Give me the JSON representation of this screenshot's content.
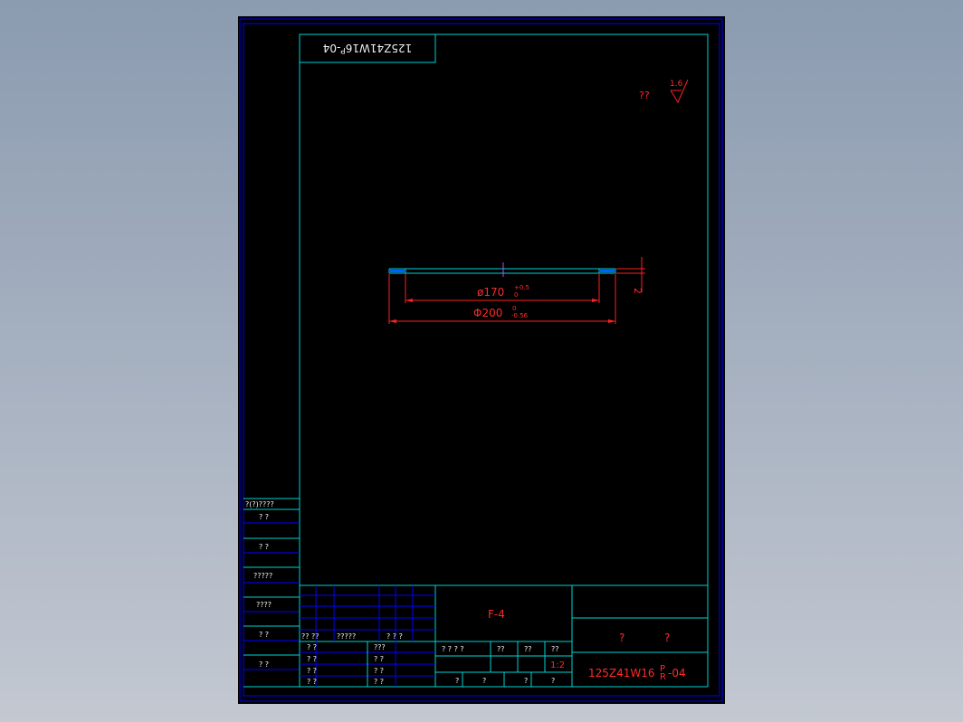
{
  "colors": {
    "background_top": "#8b9bb0",
    "sheet": "#000000",
    "frame": "#0000ff",
    "border": "#00d4d4",
    "annotation": "#ff2a2a",
    "text": "#f0f0f0"
  },
  "drawing_code_rotated": "125Z41W16",
  "drawing_code_rotated_suffix": "-04",
  "drawing_code_rotated_sup": "P",
  "roughness": {
    "value": "1.6",
    "mark": "??"
  },
  "dims": {
    "inner": {
      "prefix": "ø170",
      "upper": "+0.5",
      "lower": "0"
    },
    "outer": {
      "prefix": "Φ200",
      "upper": "0",
      "lower": "-0.56"
    },
    "thickness": "2"
  },
  "side_panel": [
    "?(?)????",
    "?   ?",
    "?   ?",
    "?????",
    "????",
    "?   ?",
    "?   ?"
  ],
  "title_block": {
    "material": "F-4",
    "name_a": "?",
    "name_b": "?",
    "code": "125Z41W16",
    "code_sup": "P",
    "code_sub": "R",
    "code_suffix": "-04",
    "scale": "1:2",
    "header_row": [
      "?? ??",
      "?????",
      "?  ?  ?"
    ],
    "left_labels": [
      "?  ?",
      "?  ?",
      "?  ?",
      "?  ?"
    ],
    "mid_labels": [
      "???",
      "?  ?",
      "?  ?",
      "?  ?"
    ],
    "stage_row": [
      "?  ?  ?  ?",
      "??",
      "??",
      "??"
    ],
    "bottom_row": [
      "?",
      "?",
      "?",
      "?"
    ]
  }
}
